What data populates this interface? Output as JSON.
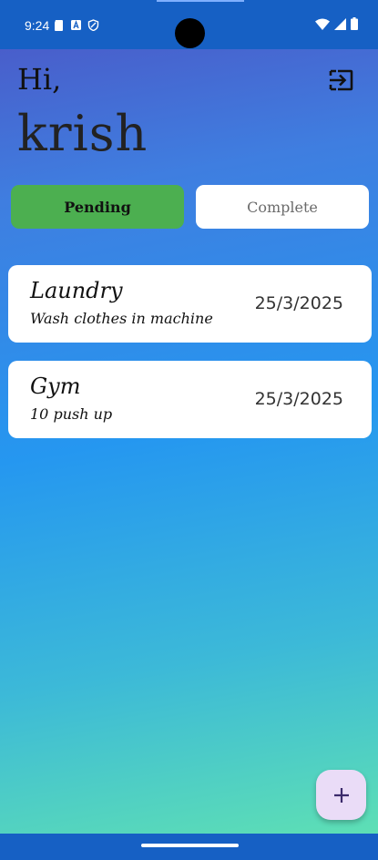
{
  "status_bar": {
    "time": "9:24",
    "left_icons": [
      "sd-card-icon",
      "a-box-icon",
      "shield-icon"
    ],
    "right_icons": [
      "wifi-icon",
      "signal-icon",
      "battery-icon"
    ]
  },
  "header": {
    "greeting": "Hi,",
    "username": "krish",
    "logout_icon": "logout-icon"
  },
  "tabs": [
    {
      "label": "Pending",
      "active": true
    },
    {
      "label": "Complete",
      "active": false
    }
  ],
  "tasks": [
    {
      "title": "Laundry",
      "description": "Wash clothes in machine",
      "date": "25/3/2025"
    },
    {
      "title": "Gym",
      "description": "10 push up",
      "date": "25/3/2025"
    }
  ],
  "fab": {
    "icon": "plus-icon"
  },
  "colors": {
    "status_bar": "#1660c4",
    "pending_tab": "#4caf50",
    "complete_tab": "#ffffff",
    "fab": "#eadcf7",
    "fab_icon": "#3b2a6b"
  }
}
